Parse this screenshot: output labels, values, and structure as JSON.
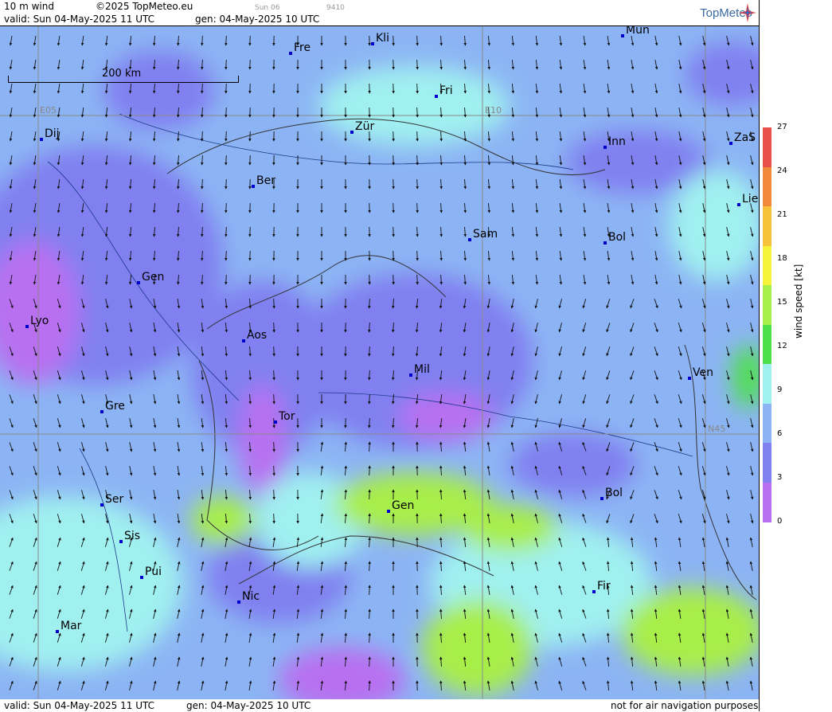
{
  "header": {
    "param": "10 m wind",
    "copyright": "©2025 TopMeteo.eu",
    "day_tab": "Sun 06",
    "code": "9410",
    "valid": "valid:  Sun  04-May-2025  11 UTC",
    "gen": "gen: 04-May-2025 10 UTC",
    "logo": "TopMeteo"
  },
  "footer": {
    "valid": "valid:  Sun  04-May-2025  11 UTC",
    "gen": "gen: 04-May-2025 10 UTC",
    "note": "not for air navigation purposes"
  },
  "map": {
    "scale_label": "200 km",
    "grid_labels": [
      "E05",
      "E10",
      "N45"
    ],
    "cities": [
      "Kli",
      "Mün",
      "Fre",
      "Fri",
      "Dij",
      "Zür",
      "Inn",
      "ZaS",
      "Ber",
      "Lie",
      "Sam",
      "Bol",
      "Gen",
      "Lyo",
      "Aos",
      "Mil",
      "Ven",
      "Gre",
      "Tor",
      "Gen",
      "Bol",
      "Ser",
      "Sis",
      "Pui",
      "Nic",
      "Fir",
      "Mar"
    ]
  },
  "legend": {
    "unit_label": "wind speed [kt]",
    "ticks": [
      "27",
      "24",
      "21",
      "18",
      "15",
      "12",
      "9",
      "6",
      "3",
      "0"
    ],
    "colors": [
      "#e8504a",
      "#f08a3a",
      "#f6c23a",
      "#f4f33a",
      "#a8ee4a",
      "#4ee04a",
      "#a0f0f0",
      "#8cb4f4",
      "#8080f0",
      "#b870f0"
    ]
  }
}
